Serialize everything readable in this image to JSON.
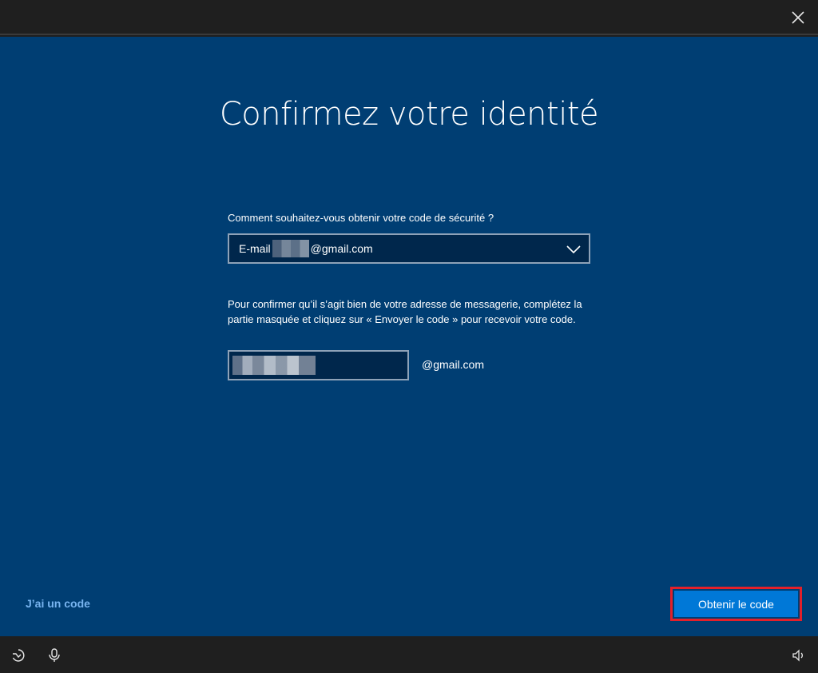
{
  "page": {
    "title": "Confirmez votre identité"
  },
  "form": {
    "question": "Comment souhaitez-vous obtenir votre code de sécurité ?",
    "method": {
      "prefix": "E-mail",
      "suffix": "@gmail.com"
    },
    "instructions": "Pour confirmer qu’il s’agit bien de votre adresse de messagerie, complétez la partie masquée et cliquez sur « Envoyer le code » pour recevoir votre code.",
    "email_suffix": "@gmail.com"
  },
  "footer": {
    "have_code_link": "J’ai un code",
    "get_code_button": "Obtenir le code"
  },
  "icons": {
    "close": "close-icon",
    "chevron": "chevron-down-icon",
    "ease_of_access": "ease-of-access-icon",
    "microphone": "microphone-icon",
    "volume": "volume-icon"
  },
  "colors": {
    "background": "#003e73",
    "input_background": "#00274c",
    "accent": "#0078d7",
    "link": "#78b4f0",
    "highlight": "#e3202a"
  }
}
